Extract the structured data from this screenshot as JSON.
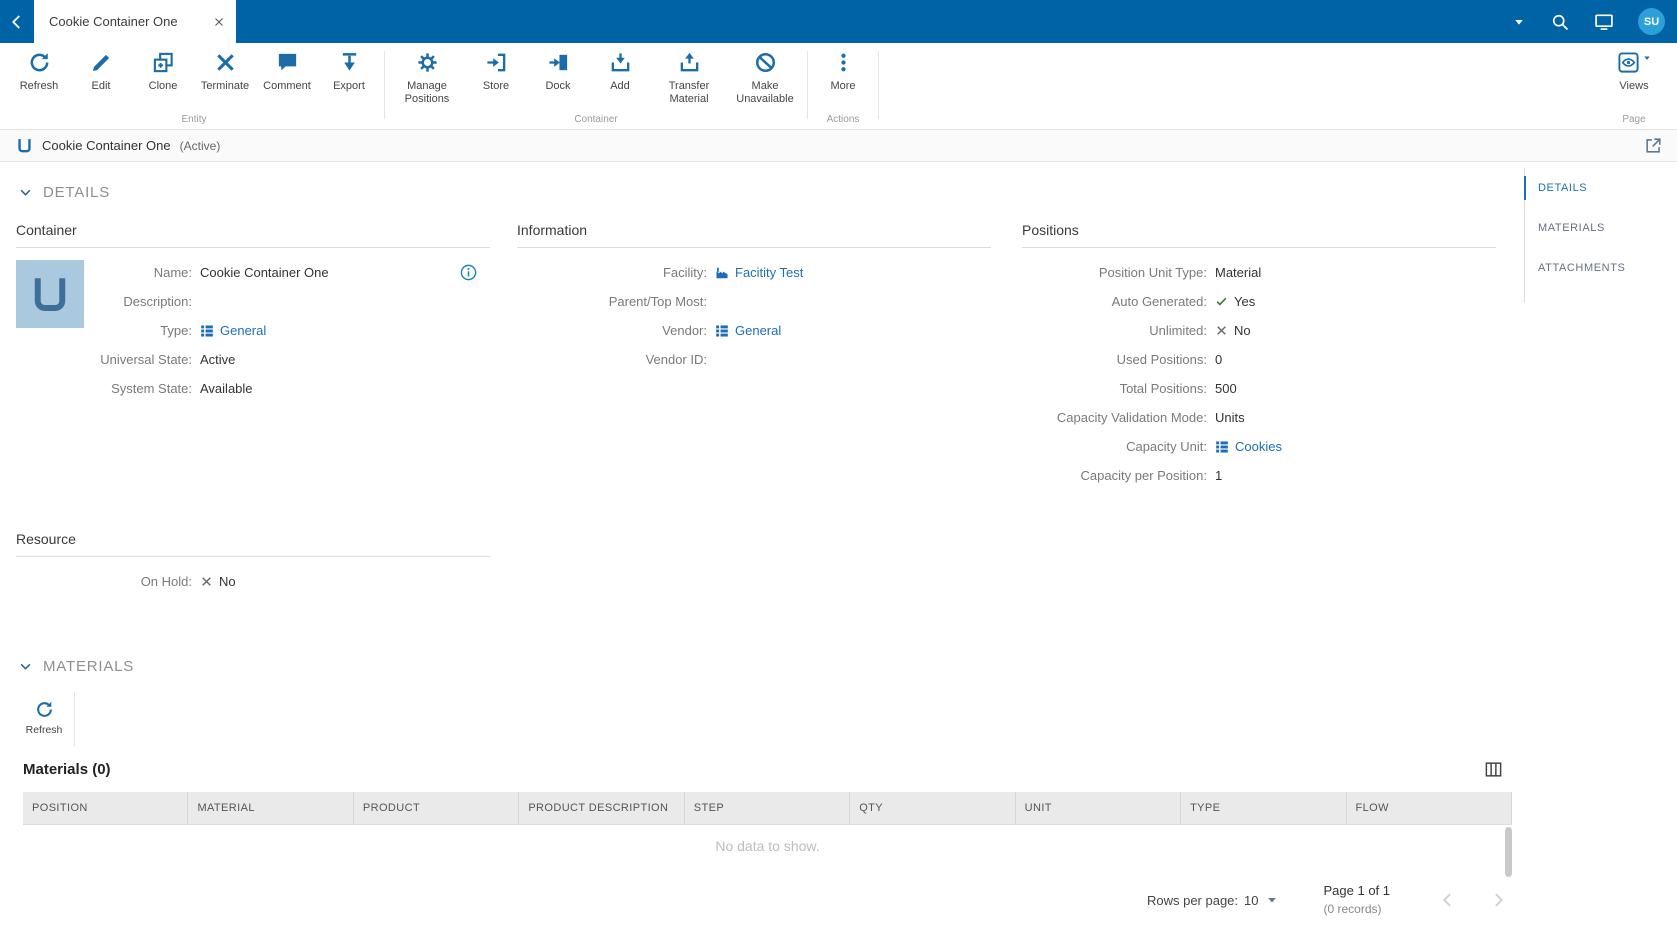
{
  "colors": {
    "topbar": "#0063a5",
    "icon": "#1b6ca8",
    "link": "#1e6eb6",
    "avatar": "#2da0da",
    "check": "#2e7d32",
    "cross": "#666666"
  },
  "topbar": {
    "tab_title": "Cookie Container One",
    "avatar_initials": "SU"
  },
  "ribbon": {
    "groups": [
      {
        "label": "Entity",
        "buttons": [
          {
            "name": "refresh",
            "label": "Refresh"
          },
          {
            "name": "edit",
            "label": "Edit"
          },
          {
            "name": "clone",
            "label": "Clone"
          },
          {
            "name": "terminate",
            "label": "Terminate"
          },
          {
            "name": "comment",
            "label": "Comment"
          },
          {
            "name": "export",
            "label": "Export"
          }
        ]
      },
      {
        "label": "Container",
        "buttons": [
          {
            "name": "manage-positions",
            "label": "Manage Positions"
          },
          {
            "name": "store",
            "label": "Store"
          },
          {
            "name": "dock",
            "label": "Dock"
          },
          {
            "name": "add",
            "label": "Add"
          },
          {
            "name": "transfer-material",
            "label": "Transfer Material"
          },
          {
            "name": "make-unavailable",
            "label": "Make Unavailable"
          }
        ]
      },
      {
        "label": "Actions",
        "buttons": [
          {
            "name": "more",
            "label": "More"
          }
        ]
      }
    ],
    "page_group": {
      "label": "Page",
      "views_label": "Views"
    }
  },
  "entity_header": {
    "title": "Cookie Container One",
    "state": "(Active)"
  },
  "side_nav": {
    "items": [
      {
        "label": "DETAILS",
        "active": true
      },
      {
        "label": "MATERIALS",
        "active": false
      },
      {
        "label": "ATTACHMENTS",
        "active": false
      }
    ]
  },
  "details": {
    "section_title": "DETAILS",
    "columns": [
      {
        "title": "Container",
        "fields": [
          {
            "label": "Name:",
            "type": "text",
            "value": "Cookie Container One",
            "info": true
          },
          {
            "label": "Description:",
            "type": "text",
            "value": ""
          },
          {
            "label": "Type:",
            "type": "link",
            "icon": "list",
            "value": "General"
          },
          {
            "label": "Universal State:",
            "type": "text",
            "value": "Active"
          },
          {
            "label": "System State:",
            "type": "text",
            "value": "Available"
          }
        ]
      },
      {
        "title": "Information",
        "fields": [
          {
            "label": "Facility:",
            "type": "link",
            "icon": "factory",
            "value": "Facitity Test"
          },
          {
            "label": "Parent/Top Most:",
            "type": "text",
            "value": ""
          },
          {
            "label": "Vendor:",
            "type": "link",
            "icon": "list",
            "value": "General"
          },
          {
            "label": "Vendor ID:",
            "type": "text",
            "value": ""
          }
        ]
      },
      {
        "title": "Positions",
        "fields": [
          {
            "label": "Position Unit Type:",
            "type": "text",
            "value": "Material"
          },
          {
            "label": "Auto Generated:",
            "type": "bool",
            "value": "Yes"
          },
          {
            "label": "Unlimited:",
            "type": "bool",
            "value": "No"
          },
          {
            "label": "Used Positions:",
            "type": "text",
            "value": "0"
          },
          {
            "label": "Total Positions:",
            "type": "text",
            "value": "500"
          },
          {
            "label": "Capacity Validation Mode:",
            "type": "text",
            "value": "Units"
          },
          {
            "label": "Capacity Unit:",
            "type": "link",
            "icon": "list",
            "value": "Cookies"
          },
          {
            "label": "Capacity per Position:",
            "type": "text",
            "value": "1"
          }
        ]
      }
    ],
    "resource": {
      "title": "Resource",
      "fields": [
        {
          "label": "On Hold:",
          "type": "bool",
          "value": "No"
        }
      ]
    }
  },
  "materials": {
    "section_title": "MATERIALS",
    "refresh_label": "Refresh",
    "table_title": "Materials (0)",
    "columns": [
      "POSITION",
      "MATERIAL",
      "PRODUCT",
      "PRODUCT DESCRIPTION",
      "STEP",
      "QTY",
      "UNIT",
      "TYPE",
      "FLOW"
    ],
    "empty_text": "No data to show.",
    "pagination": {
      "rows_per_page_label": "Rows per page:",
      "rows_per_page": "10",
      "page_info": "Page 1 of 1",
      "records": "(0 records)"
    }
  }
}
